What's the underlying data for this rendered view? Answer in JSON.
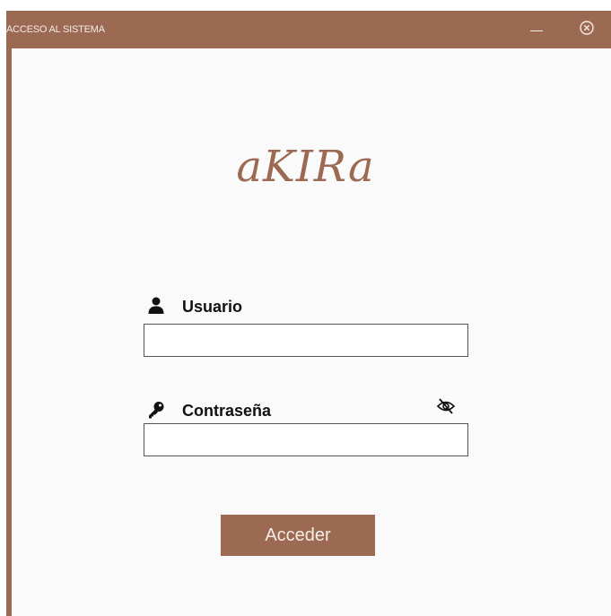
{
  "window": {
    "title": "ACCESO AL SISTEMA"
  },
  "brand": {
    "name": "aKIRa"
  },
  "login": {
    "user_label": "Usuario",
    "user_value": "",
    "password_label": "Contraseña",
    "password_value": "",
    "submit_label": "Acceder"
  },
  "icons": {
    "user": "user-icon",
    "key": "key-icon",
    "password_visibility": "eye-off-icon",
    "minimize": "minimize-icon",
    "close": "close-icon"
  },
  "colors": {
    "accent": "#9c6a52",
    "background": "#fafafa",
    "title_text": "#f3ece8"
  }
}
